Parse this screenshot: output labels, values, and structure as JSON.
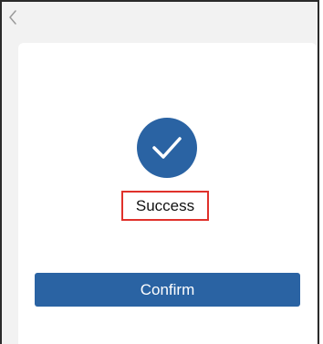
{
  "header": {
    "back_icon": "chevron-left-icon"
  },
  "result": {
    "icon": "check-icon",
    "status_text": "Success"
  },
  "actions": {
    "confirm_label": "Confirm"
  },
  "colors": {
    "primary": "#2a63a3",
    "highlight_border": "#e0312b",
    "page_bg": "#f2f2f2",
    "card_bg": "#ffffff"
  }
}
